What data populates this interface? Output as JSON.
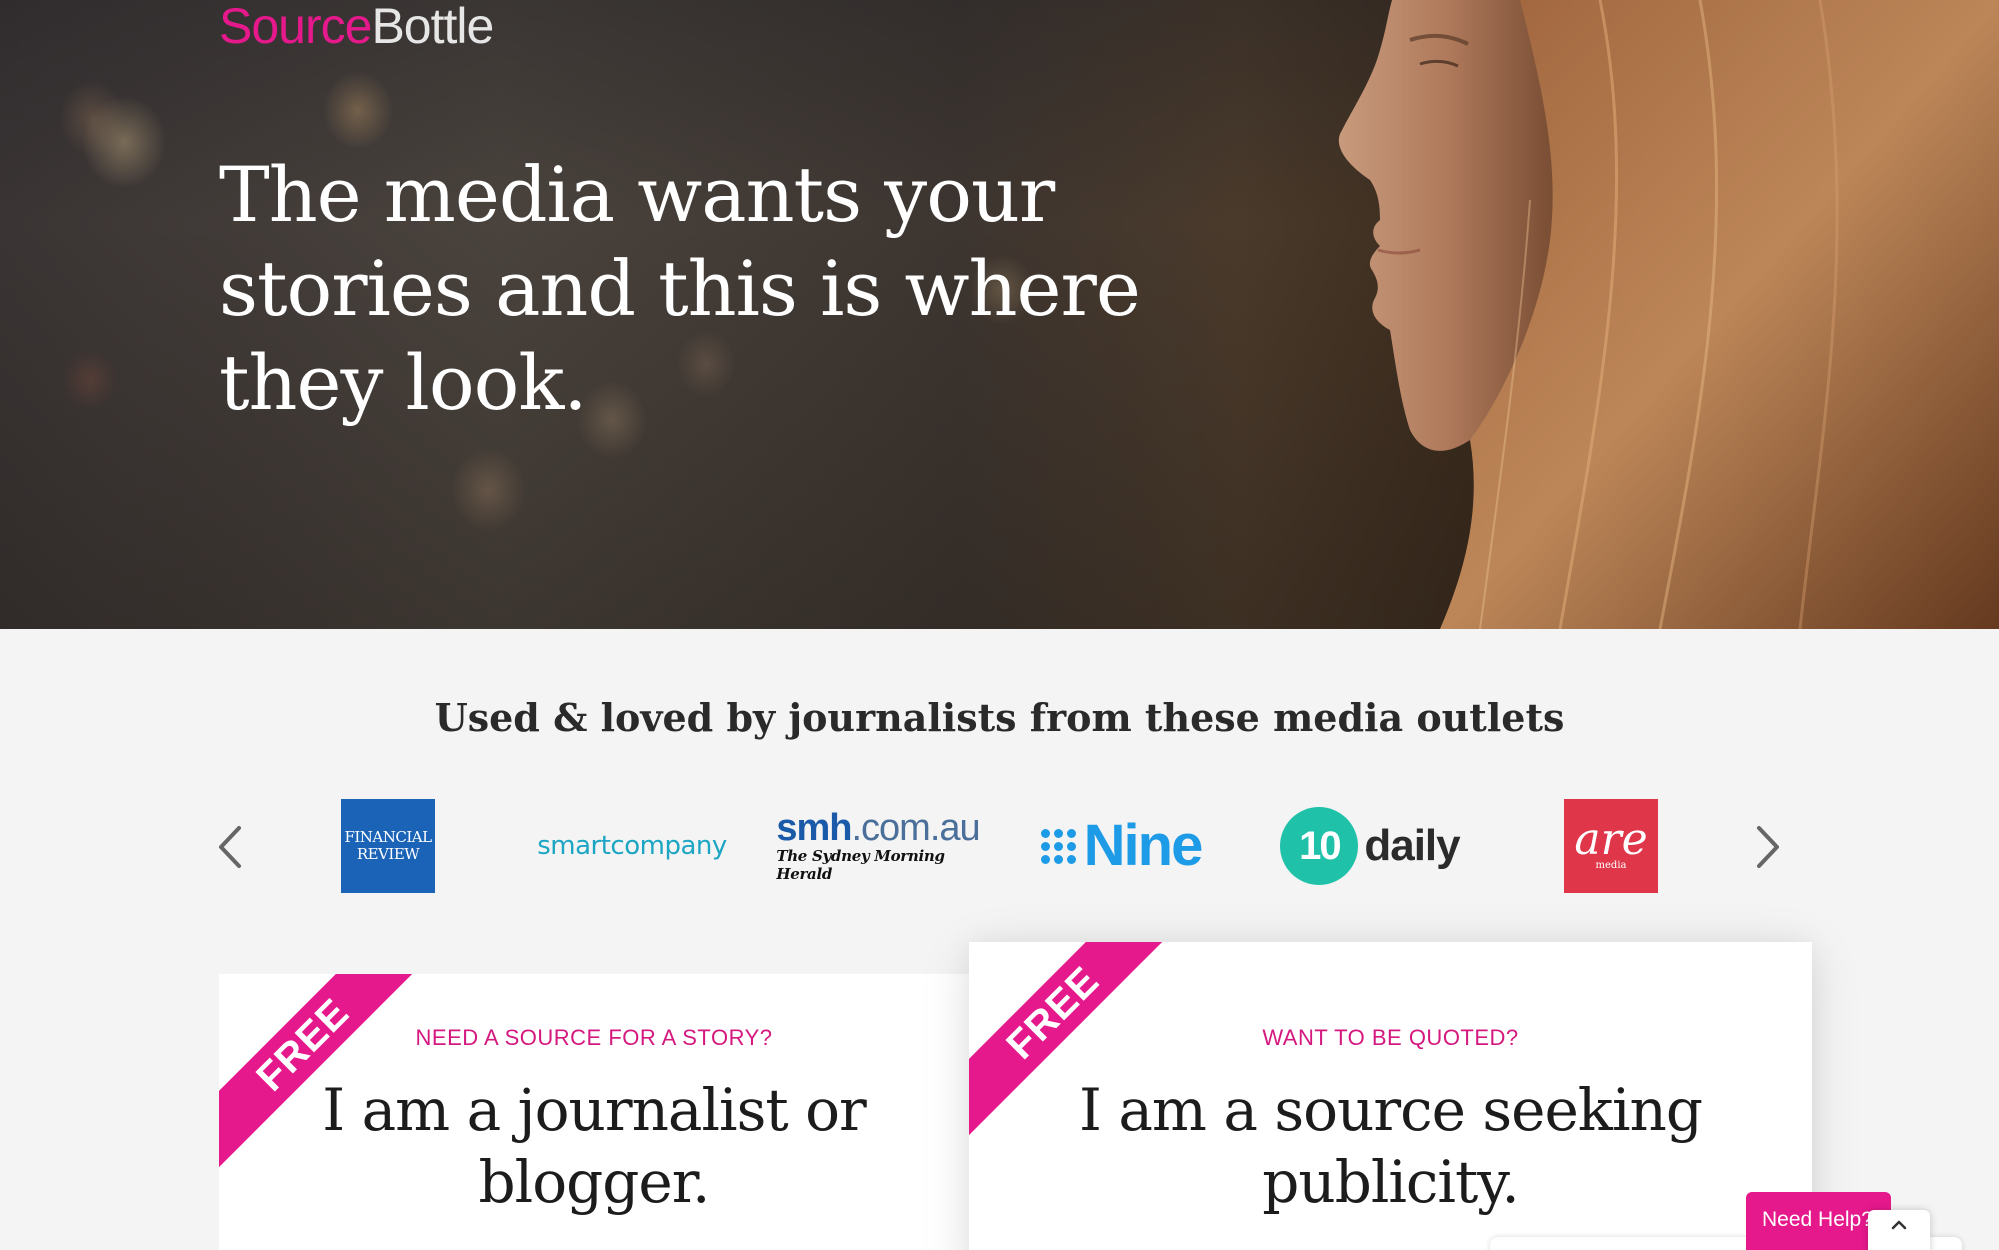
{
  "brand": {
    "source": "Source",
    "bottle": "Bottle"
  },
  "hero": {
    "headline": "The media wants your stories and this is where they look."
  },
  "outlets": {
    "title": "Used & loved by journalists from these media outlets",
    "logos": {
      "afr_line1": "FINANCIAL",
      "afr_line2": "REVIEW",
      "smartcompany": "smartcompany",
      "smh_main": "smh",
      "smh_domain": ".com.au",
      "smh_sub": "The Sydney Morning Herald",
      "nine": "Nine",
      "ten_num": "10",
      "ten_daily": "daily",
      "are_word": "are",
      "are_media": "media"
    },
    "prev_icon": "chevron-left-icon",
    "next_icon": "chevron-right-icon"
  },
  "cards": {
    "journalist": {
      "ribbon": "FREE",
      "kicker": "NEED A SOURCE FOR A STORY?",
      "heading": "I am a journalist or blogger."
    },
    "source": {
      "ribbon": "FREE",
      "kicker": "WANT TO BE QUOTED?",
      "heading": "I am a source seeking publicity."
    }
  },
  "widgets": {
    "help": "Need Help?",
    "scroll_top_icon": "chevron-up-icon"
  },
  "colors": {
    "brand_pink": "#e6198c",
    "kicker_pink": "#d4187f",
    "page_bg": "#f4f4f4"
  }
}
